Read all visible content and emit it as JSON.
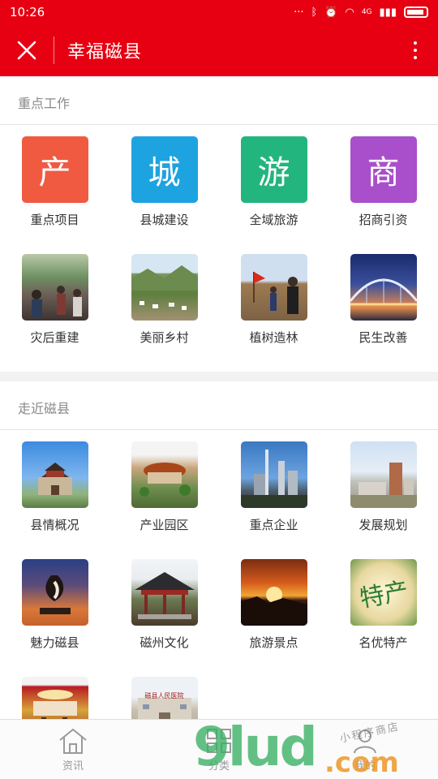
{
  "status_bar": {
    "time": "10:26",
    "network_label": "4G"
  },
  "app_bar": {
    "title": "幸福磁县"
  },
  "sections": [
    {
      "title": "重点工作",
      "items": [
        {
          "label": "重点项目",
          "glyph": "产",
          "color": "#f05a41"
        },
        {
          "label": "县城建设",
          "glyph": "城",
          "color": "#1da3e0"
        },
        {
          "label": "全域旅游",
          "glyph": "游",
          "color": "#22b57e"
        },
        {
          "label": "招商引资",
          "glyph": "商",
          "color": "#a94fcb"
        },
        {
          "label": "灾后重建",
          "glyph": "",
          "photo": "crowd"
        },
        {
          "label": "美丽乡村",
          "glyph": "",
          "photo": "valley"
        },
        {
          "label": "植树造林",
          "glyph": "",
          "photo": "planting"
        },
        {
          "label": "民生改善",
          "glyph": "",
          "photo": "bridge"
        }
      ]
    },
    {
      "title": "走近磁县",
      "items": [
        {
          "label": "县情概况",
          "glyph": "",
          "photo": "gate-tower"
        },
        {
          "label": "产业园区",
          "glyph": "",
          "photo": "park-model"
        },
        {
          "label": "重点企业",
          "glyph": "",
          "photo": "factory"
        },
        {
          "label": "发展规划",
          "glyph": "",
          "photo": "city"
        },
        {
          "label": "魅力磁县",
          "glyph": "",
          "photo": "sculpture"
        },
        {
          "label": "磁州文化",
          "glyph": "",
          "photo": "pavilion"
        },
        {
          "label": "旅游景点",
          "glyph": "",
          "photo": "sunset"
        },
        {
          "label": "名优特产",
          "glyph": "特产",
          "photo": "specialty"
        },
        {
          "label": "",
          "glyph": "",
          "photo": "stage"
        },
        {
          "label": "",
          "glyph": "",
          "photo": "government",
          "caption": "磁县人民医院"
        }
      ]
    }
  ],
  "tab_bar": [
    {
      "label": "资讯",
      "icon": "home-icon"
    },
    {
      "label": "分类",
      "icon": "grid-icon"
    },
    {
      "label": "我的",
      "icon": "person-icon"
    }
  ],
  "watermark": {
    "brand": "9lud",
    "suffix": ".com",
    "shop": "小程序商店"
  }
}
